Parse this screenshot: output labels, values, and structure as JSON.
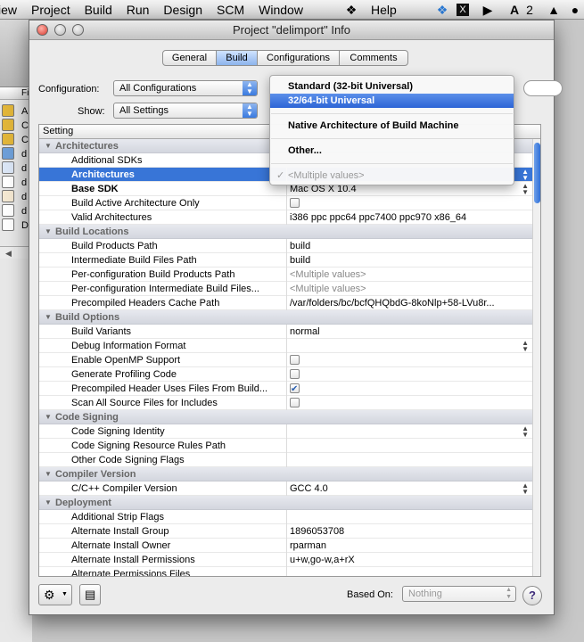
{
  "menubar": {
    "items": [
      "iew",
      "Project",
      "Build",
      "Run",
      "Design",
      "SCM",
      "Window",
      "Help"
    ],
    "script_icon": "script-menu-icon",
    "right_badge": "2"
  },
  "background_window": {
    "header": "Fi",
    "items": [
      "A",
      "C",
      "C",
      "d",
      "d",
      "d",
      "d",
      "d",
      "D"
    ]
  },
  "window": {
    "title": "Project \"delimport\" Info",
    "tabs": [
      "General",
      "Build",
      "Configurations",
      "Comments"
    ],
    "active_tab": "Build",
    "configuration_label": "Configuration:",
    "configuration_value": "All Configurations",
    "show_label": "Show:",
    "show_value": "All Settings",
    "table_header": "Setting",
    "rows": [
      {
        "type": "group",
        "name": "Architectures"
      },
      {
        "name": "Additional SDKs",
        "value": ""
      },
      {
        "name": "Architectures",
        "value": "",
        "selected": true,
        "bold": true,
        "stepper": true
      },
      {
        "name": "Base SDK",
        "value": "Mac OS X 10.4",
        "bold": true,
        "stepper": true
      },
      {
        "name": "Build Active Architecture Only",
        "checkbox": false
      },
      {
        "name": "Valid Architectures",
        "value": "i386 ppc ppc64 ppc7400 ppc970 x86_64"
      },
      {
        "type": "group",
        "name": "Build Locations"
      },
      {
        "name": "Build Products Path",
        "value": "build"
      },
      {
        "name": "Intermediate Build Files Path",
        "value": "build"
      },
      {
        "name": "Per-configuration Build Products Path",
        "value": "<Multiple values>",
        "gray": true
      },
      {
        "name": "Per-configuration Intermediate Build Files...",
        "value": "<Multiple values>",
        "gray": true
      },
      {
        "name": "Precompiled Headers Cache Path",
        "value": "/var/folders/bc/bcfQHQbdG-8koNlp+58-LVu8r..."
      },
      {
        "type": "group",
        "name": "Build Options"
      },
      {
        "name": "Build Variants",
        "value": "normal"
      },
      {
        "name": "Debug Information Format",
        "value": "",
        "stepper": true
      },
      {
        "name": "Enable OpenMP Support",
        "checkbox": false
      },
      {
        "name": "Generate Profiling Code",
        "checkbox": false
      },
      {
        "name": "Precompiled Header Uses Files From Build...",
        "checkbox": true
      },
      {
        "name": "Scan All Source Files for Includes",
        "checkbox": false
      },
      {
        "type": "group",
        "name": "Code Signing"
      },
      {
        "name": "Code Signing Identity",
        "value": "",
        "stepper": true
      },
      {
        "name": "Code Signing Resource Rules Path",
        "value": ""
      },
      {
        "name": "Other Code Signing Flags",
        "value": ""
      },
      {
        "type": "group",
        "name": "Compiler Version"
      },
      {
        "name": "C/C++ Compiler Version",
        "value": "GCC 4.0",
        "stepper": true
      },
      {
        "type": "group",
        "name": "Deployment"
      },
      {
        "name": "Additional Strip Flags",
        "value": ""
      },
      {
        "name": "Alternate Install Group",
        "value": "1896053708"
      },
      {
        "name": "Alternate Install Owner",
        "value": "rparman"
      },
      {
        "name": "Alternate Install Permissions",
        "value": "u+w,go-w,a+rX"
      },
      {
        "name": "Alternate Permissions Files",
        "value": ""
      }
    ],
    "dropdown_menu": {
      "items": [
        {
          "label": "Standard (32-bit Universal)",
          "state": "normal"
        },
        {
          "label": "32/64-bit Universal",
          "state": "highlighted"
        },
        {
          "label": "Native Architecture of Build Machine",
          "state": "normal"
        },
        {
          "label": "Other...",
          "state": "normal"
        },
        {
          "label": "<Multiple values>",
          "state": "disabled",
          "checked": true
        }
      ]
    },
    "bottom": {
      "based_on_label": "Based On:",
      "based_on_value": "Nothing",
      "help_label": "?"
    }
  },
  "colors": {
    "selection": "#3875d7",
    "menu_highlight": "#2d65d6",
    "group_header": "#d3d6de",
    "window_bg": "#ececec"
  }
}
